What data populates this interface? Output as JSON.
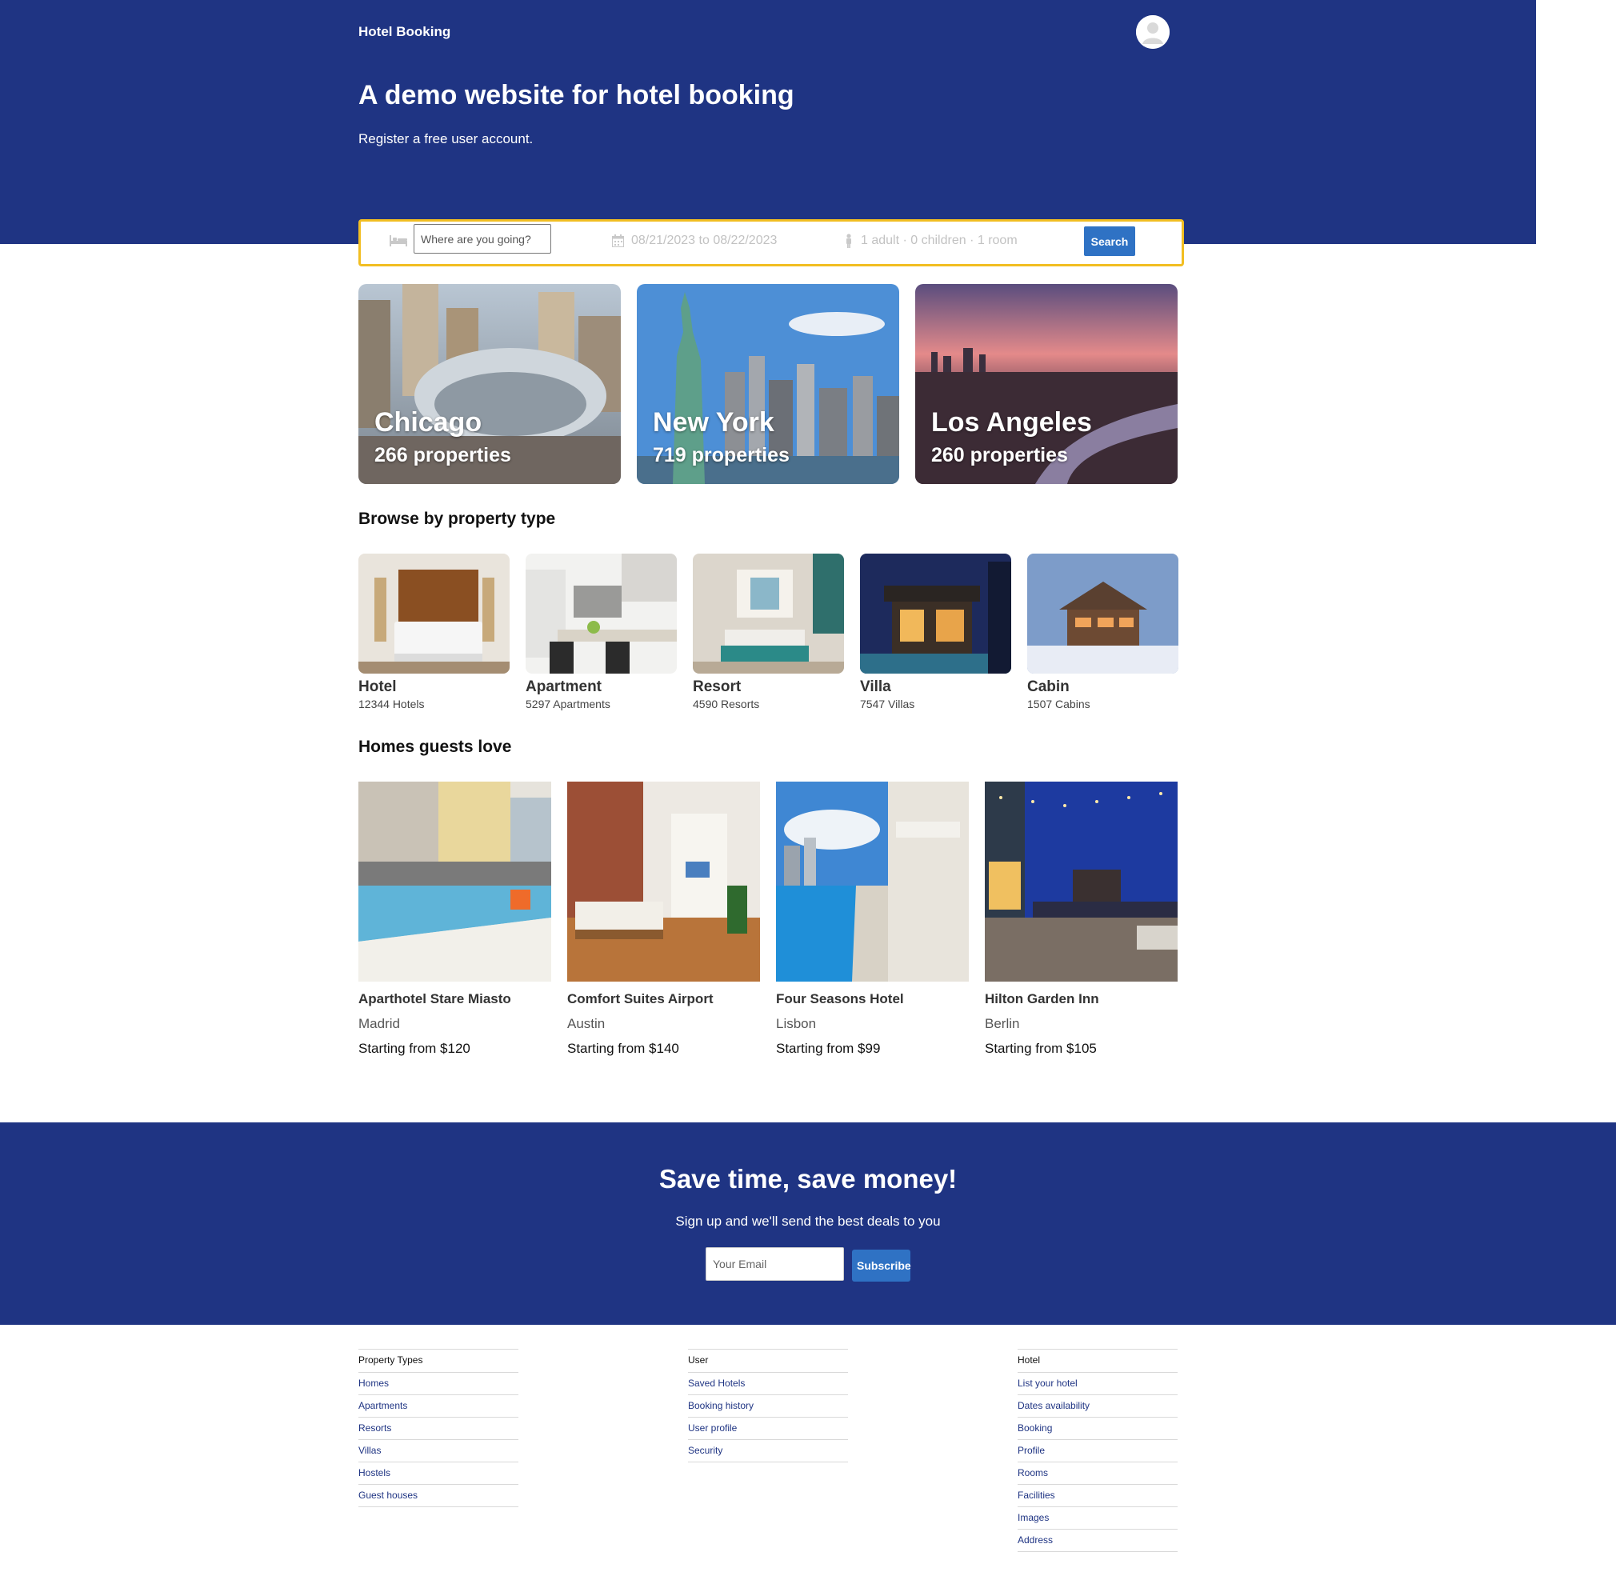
{
  "header": {
    "brand": "Hotel Booking",
    "headline": "A demo website for hotel booking",
    "subheadline": "Register a free user account."
  },
  "search": {
    "destination_placeholder": "Where are you going?",
    "dates": "08/21/2023 to 08/22/2023",
    "guests": "1 adult · 0 children · 1 room",
    "button": "Search"
  },
  "cities": [
    {
      "name": "Chicago",
      "count": "266 properties"
    },
    {
      "name": "New York",
      "count": "719 properties"
    },
    {
      "name": "Los Angeles",
      "count": "260 properties"
    }
  ],
  "property_types": {
    "title": "Browse by property type",
    "items": [
      {
        "name": "Hotel",
        "count": "12344 Hotels"
      },
      {
        "name": "Apartment",
        "count": "5297 Apartments"
      },
      {
        "name": "Resort",
        "count": "4590 Resorts"
      },
      {
        "name": "Villa",
        "count": "7547 Villas"
      },
      {
        "name": "Cabin",
        "count": "1507 Cabins"
      }
    ]
  },
  "homes": {
    "title": "Homes guests love",
    "items": [
      {
        "name": "Aparthotel Stare Miasto",
        "city": "Madrid",
        "price": "Starting from $120"
      },
      {
        "name": "Comfort Suites Airport",
        "city": "Austin",
        "price": "Starting from $140"
      },
      {
        "name": "Four Seasons Hotel",
        "city": "Lisbon",
        "price": "Starting from $99"
      },
      {
        "name": "Hilton Garden Inn",
        "city": "Berlin",
        "price": "Starting from $105"
      }
    ]
  },
  "newsletter": {
    "title": "Save time, save money!",
    "subtitle": "Sign up and we'll send the best deals to you",
    "email_placeholder": "Your Email",
    "button": "Subscribe"
  },
  "footer": {
    "columns": [
      {
        "title": "Property Types",
        "links": [
          "Homes",
          "Apartments",
          "Resorts",
          "Villas",
          "Hostels",
          "Guest houses"
        ]
      },
      {
        "title": "User",
        "links": [
          "Saved Hotels",
          "Booking history",
          "User profile",
          "Security"
        ]
      },
      {
        "title": "Hotel",
        "links": [
          "List your hotel",
          "Dates availability",
          "Booking",
          "Profile",
          "Rooms",
          "Facilities",
          "Images",
          "Address"
        ]
      }
    ]
  },
  "colors": {
    "primary": "#1f3483",
    "accent": "#2f72c4",
    "search_border": "#f2be22"
  },
  "icons": [
    "avatar-icon",
    "bed-icon",
    "calendar-icon",
    "person-icon"
  ]
}
